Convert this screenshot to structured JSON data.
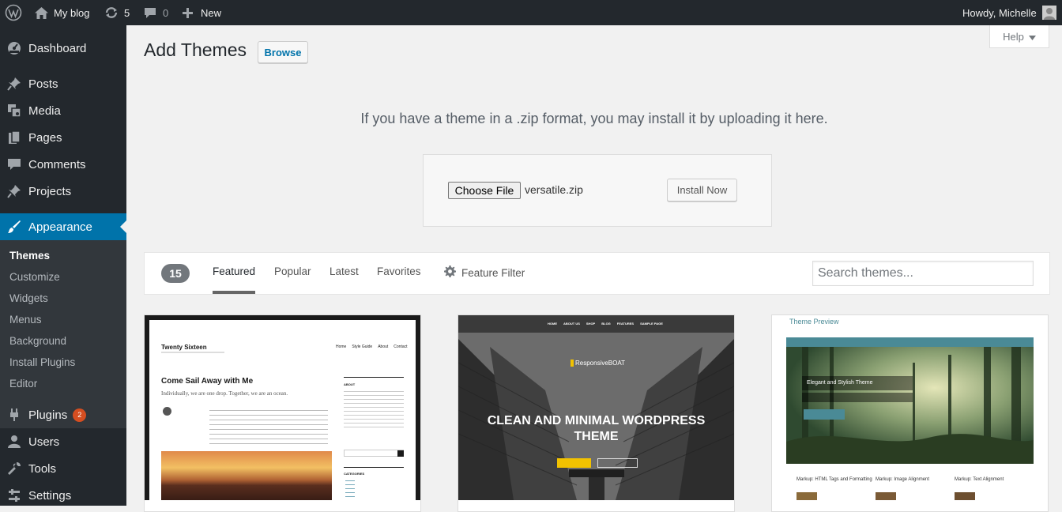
{
  "admin_bar": {
    "site_name": "My blog",
    "updates_count": "5",
    "comments_count": "0",
    "new_label": "New",
    "greeting": "Howdy, Michelle"
  },
  "sidebar": {
    "items": [
      {
        "label": "Dashboard",
        "icon": "dashboard-icon"
      },
      {
        "label": "Posts",
        "icon": "pin-icon"
      },
      {
        "label": "Media",
        "icon": "media-icon"
      },
      {
        "label": "Pages",
        "icon": "pages-icon"
      },
      {
        "label": "Comments",
        "icon": "comment-icon"
      },
      {
        "label": "Projects",
        "icon": "pin-icon"
      },
      {
        "label": "Appearance",
        "icon": "brush-icon"
      }
    ],
    "submenu": [
      "Themes",
      "Customize",
      "Widgets",
      "Menus",
      "Background",
      "Install Plugins",
      "Editor"
    ],
    "lower_items": [
      {
        "label": "Plugins",
        "icon": "plug-icon",
        "badge": "2"
      },
      {
        "label": "Users",
        "icon": "user-icon"
      },
      {
        "label": "Tools",
        "icon": "wrench-icon"
      },
      {
        "label": "Settings",
        "icon": "settings-icon"
      }
    ]
  },
  "page": {
    "title": "Add Themes",
    "browse_label": "Browse",
    "help_label": "Help"
  },
  "upload": {
    "description": "If you have a theme in a .zip format, you may install it by uploading it here.",
    "choose_file_label": "Choose File",
    "file_name": "versatile.zip",
    "install_label": "Install Now"
  },
  "filter": {
    "count": "15",
    "tabs": [
      "Featured",
      "Popular",
      "Latest",
      "Favorites"
    ],
    "feature_filter_label": "Feature Filter",
    "search_placeholder": "Search themes..."
  },
  "themes": {
    "twentysixteen": {
      "site_title": "Twenty Sixteen",
      "nav": [
        "Home",
        "Style Guide",
        "About",
        "Contact"
      ],
      "post_title": "Come Sail Away with Me",
      "post_intro": "Individually, we are one drop. Together, we are an ocean.",
      "widget_heading": "ABOUT",
      "categories_heading": "CATEGORIES"
    },
    "responsiveboat": {
      "logo_text": "ResponsiveBOAT",
      "nav": [
        "HOME",
        "ABOUT US",
        "SHOP",
        "BLOG",
        "FEATURES",
        "SAMPLE PAGE"
      ],
      "headline": "CLEAN AND MINIMAL WORDPRESS THEME"
    },
    "themepreview": {
      "site_title": "Theme Preview",
      "hero_title": "Elegant and Stylish Theme",
      "posts": [
        "Markup: HTML Tags and Formatting",
        "Markup: Image Alignment",
        "Markup: Text Alignment"
      ]
    }
  },
  "colors": {
    "admin_bg": "#23282d",
    "accent": "#0073aa",
    "submenu_bg": "#32373c",
    "badge": "#d54e21"
  }
}
